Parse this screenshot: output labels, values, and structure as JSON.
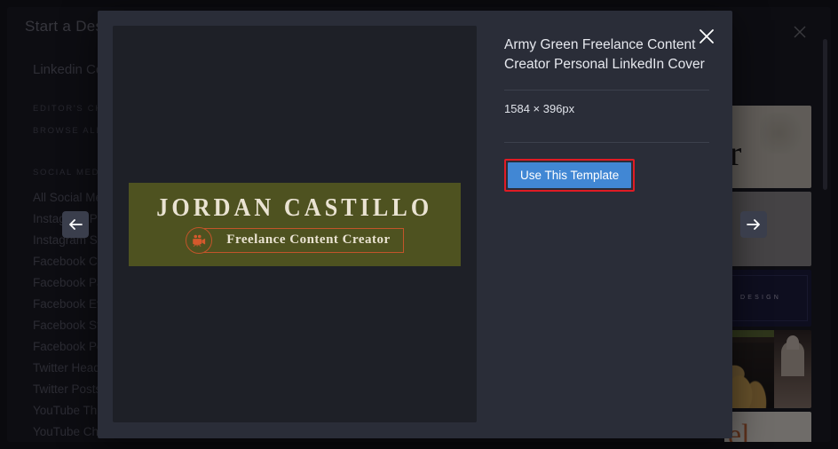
{
  "background_app": {
    "sidebar": {
      "title": "Start a Design",
      "current_category": "Linkedin Cover",
      "meta_links": [
        "EDITOR'S CHOICE",
        "BROWSE ALL TEMPLATES"
      ],
      "group_label": "SOCIAL MEDIA",
      "items": [
        "All Social Media",
        "Instagram Posts",
        "Instagram Stories",
        "Facebook Covers",
        "Facebook Page",
        "Facebook Events",
        "Facebook Stories",
        "Facebook Posts",
        "Twitter Headers",
        "Twitter Posts",
        "YouTube Thumbnails",
        "YouTube Channel Art"
      ]
    },
    "thumbnails": [
      {
        "name": "beige-serif-cover",
        "text": "r"
      },
      {
        "name": "grey-cover",
        "text": ""
      },
      {
        "name": "navy-design-cover",
        "text": "DESIGN"
      },
      {
        "name": "travel-photo-collage-cover",
        "text": ""
      },
      {
        "name": "cream-orange-cover",
        "text": "el"
      }
    ],
    "close_label": "×"
  },
  "modal": {
    "title": "Army Green Freelance Content Creator Personal LinkedIn Cover",
    "dimensions": "1584 × 396px",
    "use_template_label": "Use This Template",
    "close_icon": "close-icon",
    "highlight_color": "#e01b24",
    "button_color": "#4187d4",
    "preview": {
      "name": "JORDAN CASTILLO",
      "tagline": "Freelance Content Creator",
      "icon": "film-camera-icon",
      "background_color": "#4e5220",
      "accent_color": "#c2542a",
      "text_color": "#eae3d2"
    }
  },
  "navigation": {
    "prev_label": "←",
    "next_label": "→"
  }
}
